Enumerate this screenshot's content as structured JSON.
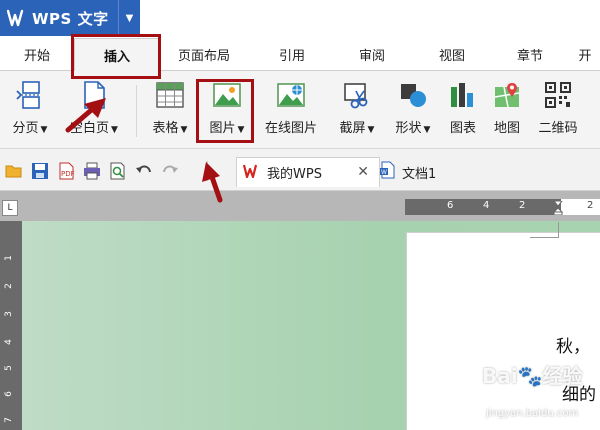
{
  "app": {
    "title": "WPS 文字",
    "logo": "W"
  },
  "tabs": [
    {
      "label": "开始"
    },
    {
      "label": "插入"
    },
    {
      "label": "页面布局"
    },
    {
      "label": "引用"
    },
    {
      "label": "审阅"
    },
    {
      "label": "视图"
    },
    {
      "label": "章节"
    },
    {
      "label": "开"
    }
  ],
  "active_tab": "插入",
  "ribbon": {
    "page_break": "分页",
    "blank_page": "空白页",
    "table": "表格",
    "picture": "图片",
    "online_picture": "在线图片",
    "screenshot": "截屏",
    "shapes": "形状",
    "chart": "图表",
    "map": "地图",
    "qrcode": "二维码"
  },
  "doc_tabs": [
    {
      "label": "我的WPS"
    },
    {
      "label": "文档1"
    }
  ],
  "ruler": {
    "h_ticks": [
      "6",
      "4",
      "2",
      "2"
    ],
    "v_ticks": [
      "1",
      "2",
      "3",
      "4",
      "5",
      "6",
      "7"
    ]
  },
  "document": {
    "line1": "秋，",
    "line2": "细的"
  },
  "watermark": {
    "brand": "Bai",
    "brand2": "经验",
    "url": "jingyan.baidu.com"
  },
  "colors": {
    "app_blue": "#2b63b8",
    "highlight": "#a30f12",
    "canvas": "#a8d3b1",
    "ribbon_bg": "#f4f4f4"
  }
}
